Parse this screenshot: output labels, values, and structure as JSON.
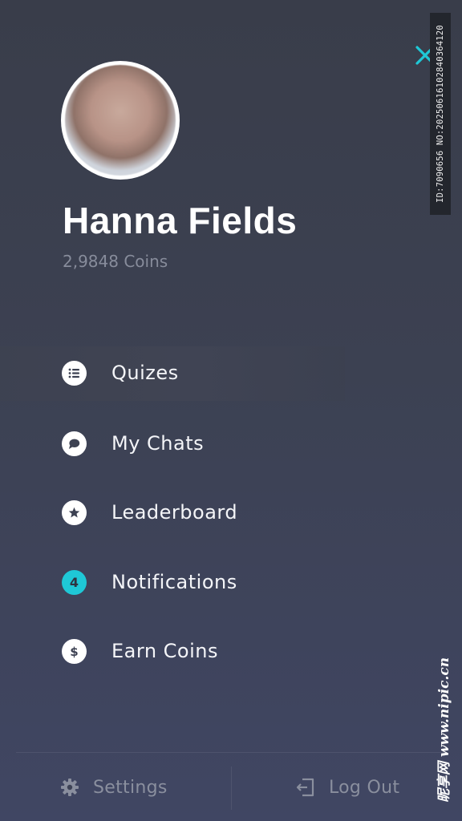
{
  "profile": {
    "name": "Hanna Fields",
    "coins": "2,9848 Coins"
  },
  "menu": {
    "items": [
      {
        "label": "Quizes",
        "icon": "list-icon"
      },
      {
        "label": "My Chats",
        "icon": "chat-bubble-icon"
      },
      {
        "label": "Leaderboard",
        "icon": "star-icon"
      },
      {
        "label": "Notifications",
        "icon": "notification-badge",
        "badge": "4"
      },
      {
        "label": "Earn Coins",
        "icon": "dollar-icon"
      }
    ]
  },
  "footer": {
    "settings_label": "Settings",
    "logout_label": "Log Out"
  },
  "watermark": {
    "id_text": "ID:7090656 NO:20250616102840364120",
    "site_text": "昵享网 www.nipic.cn"
  },
  "colors": {
    "accent": "#1fc8d6",
    "background": "#3c4152",
    "muted_text": "#878c9b"
  }
}
